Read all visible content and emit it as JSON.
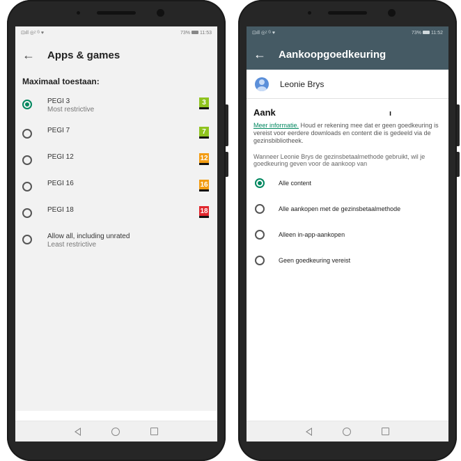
{
  "left_screen": {
    "status": {
      "left": "⊡ıll ◎ᶻ ᴳ ♥",
      "right_pct": "73%",
      "right_time": "11:53"
    },
    "title": "Apps & games",
    "subheading": "Maximaal toestaan:",
    "options": [
      {
        "label": "PEGI 3",
        "desc": "Most restrictive",
        "badge": "3",
        "badge_color": "#8fc31f",
        "checked": true
      },
      {
        "label": "PEGI 7",
        "desc": "",
        "badge": "7",
        "badge_color": "#8fc31f",
        "checked": false
      },
      {
        "label": "PEGI 12",
        "desc": "",
        "badge": "12",
        "badge_color": "#f39c12",
        "checked": false
      },
      {
        "label": "PEGI 16",
        "desc": "",
        "badge": "16",
        "badge_color": "#f39c12",
        "checked": false
      },
      {
        "label": "PEGI 18",
        "desc": "",
        "badge": "18",
        "badge_color": "#e0262d",
        "checked": false
      },
      {
        "label": "Allow all, including unrated",
        "desc": "Least restrictive",
        "badge": "",
        "badge_color": "",
        "checked": false
      }
    ]
  },
  "right_screen": {
    "status": {
      "left": "⊡ıll ◎ᶻ ᴳ ♥",
      "right_pct": "73%",
      "right_time": "11:52"
    },
    "title": "Aankoopgoedkeuring",
    "account_name": "Leonie Brys",
    "heading": "Aank",
    "heading_trunc": "ı",
    "info_link": "Meer informatie.",
    "info_text": " Houd er rekening mee dat er geen goedkeuring is vereist voor eerdere downloads en content die is gedeeld via de gezinsbibliotheek.",
    "info2": "Wanneer Leonie Brys de gezinsbetaalmethode gebruikt, wil je goedkeuring geven voor de aankoop van",
    "options": [
      {
        "label": "Alle content",
        "checked": true
      },
      {
        "label": "Alle aankopen met de gezinsbetaalmethode",
        "checked": false
      },
      {
        "label": "Alleen in-app-aankopen",
        "checked": false
      },
      {
        "label": "Geen goedkeuring vereist",
        "checked": false
      }
    ]
  },
  "colors": {
    "accent": "#01875f",
    "appbar_dark": "#455a64",
    "frame": "#262626"
  },
  "icons": {
    "back": "arrow-back-icon",
    "nav": [
      "nav-back-icon",
      "nav-home-icon",
      "nav-recent-icon"
    ]
  }
}
